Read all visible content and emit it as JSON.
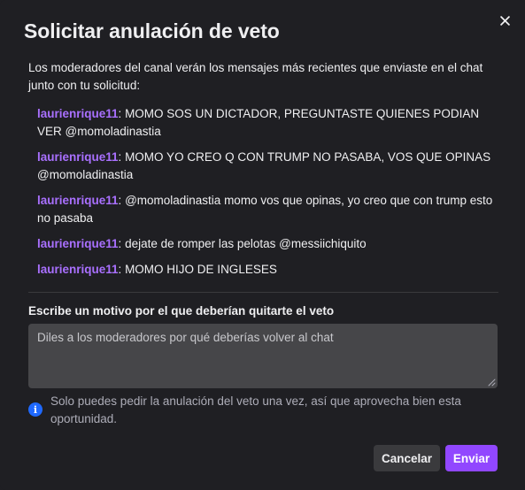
{
  "dialog": {
    "title": "Solicitar anulación de veto",
    "close_icon": "close-icon",
    "intro": "Los moderadores del canal verán los mensajes más recientes que enviaste en el chat junto con tu solicitud:"
  },
  "messages": [
    {
      "user": "laurienrique11",
      "sep": ": ",
      "text": "MOMO SOS UN DICTADOR, PREGUNTASTE QUIENES PODIAN VER @momoladinastia"
    },
    {
      "user": "laurienrique11",
      "sep": ": ",
      "text": "MOMO YO CREO Q CON TRUMP NO PASABA, VOS QUE OPINAS @momoladinastia"
    },
    {
      "user": "laurienrique11",
      "sep": ": ",
      "text": "@momoladinastia momo vos que opinas, yo creo que con trump esto no pasaba"
    },
    {
      "user": "laurienrique11",
      "sep": ": ",
      "text": "dejate de romper las pelotas @messiichiquito"
    },
    {
      "user": "laurienrique11",
      "sep": ": ",
      "text": "MOMO HIJO DE INGLESES"
    }
  ],
  "form": {
    "label": "Escribe un motivo por el que deberían quitarte el veto",
    "placeholder": "Diles a los moderadores por qué deberías volver al chat",
    "value": "",
    "info_icon": "info-icon",
    "info_text": "Solo puedes pedir la anulación del veto una vez, así que aprovecha bien esta oportunidad."
  },
  "actions": {
    "cancel_label": "Cancelar",
    "send_label": "Enviar"
  },
  "colors": {
    "background": "#1f1f23",
    "username": "#a970ff",
    "primary_button": "#9147ff",
    "secondary_button": "#3a3a3d",
    "info_icon": "#1f69ff",
    "input_background": "#464649"
  }
}
